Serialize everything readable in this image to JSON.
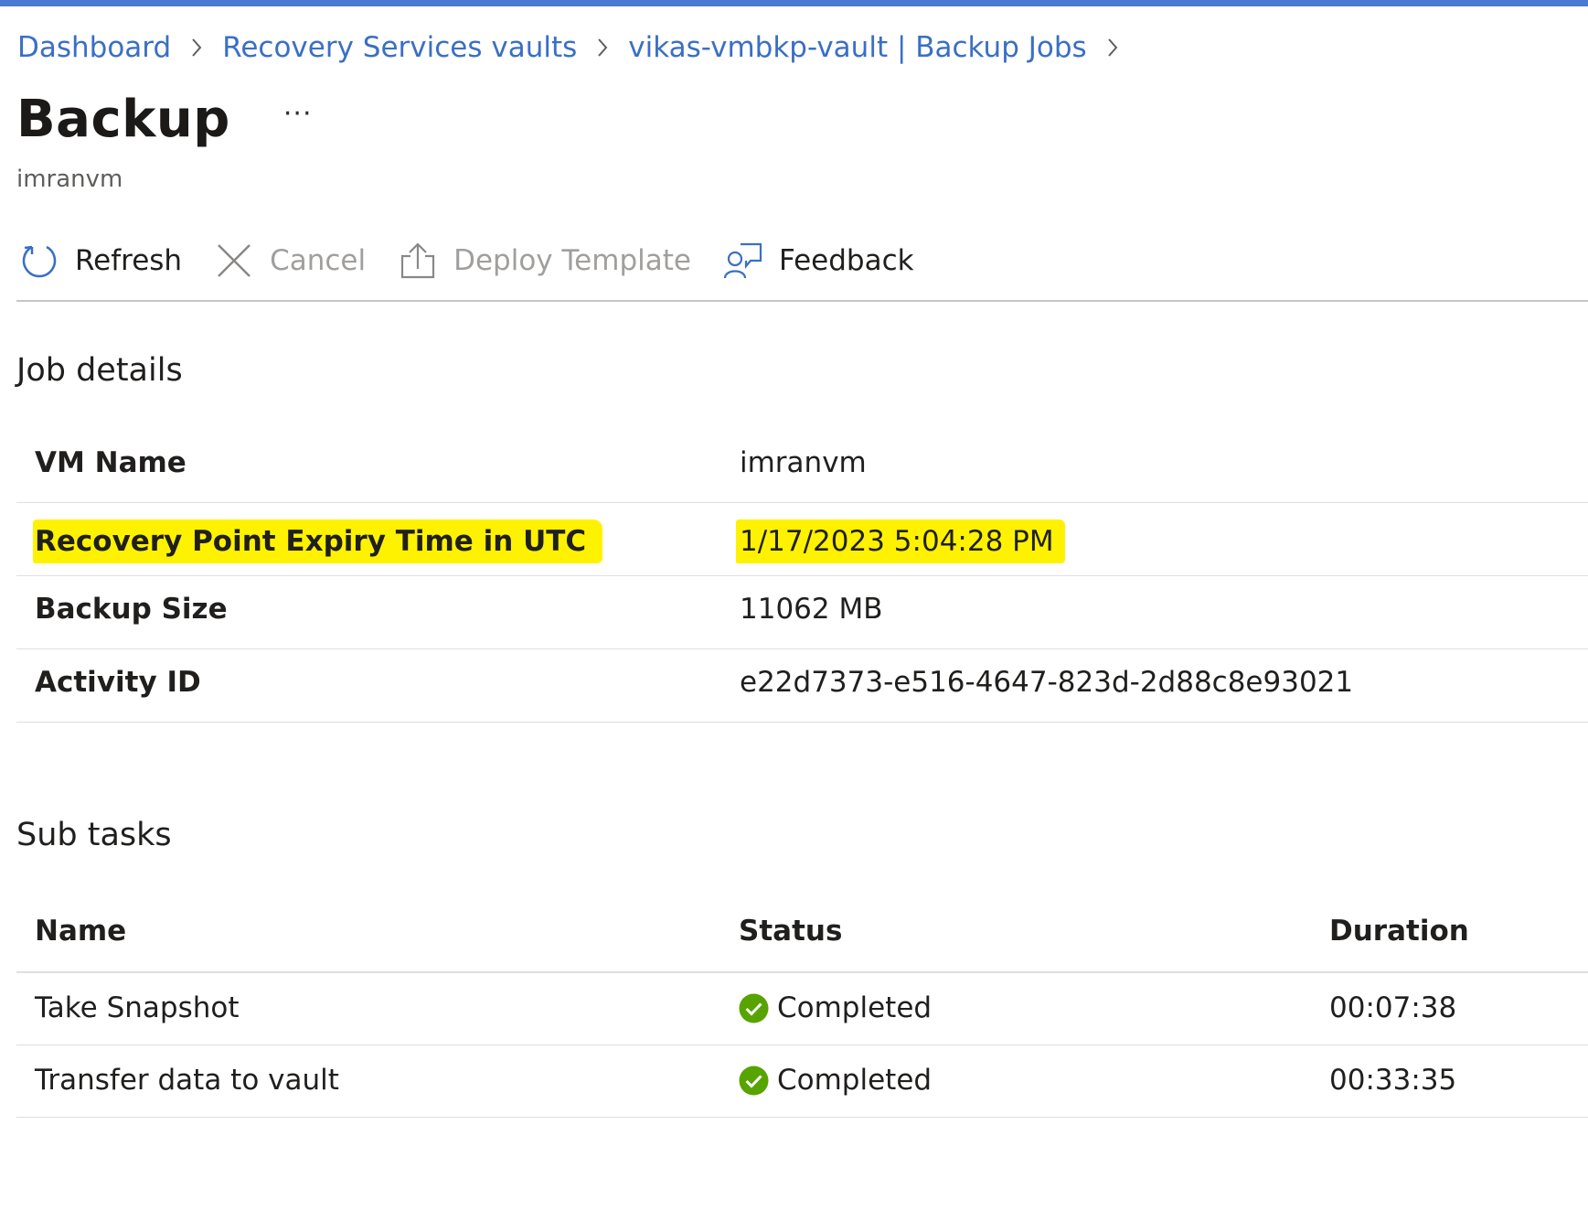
{
  "breadcrumb": {
    "items": [
      "Dashboard",
      "Recovery Services vaults",
      "vikas-vmbkp-vault | Backup Jobs"
    ]
  },
  "header": {
    "title": "Backup",
    "more_label": "···",
    "subtitle": "imranvm"
  },
  "toolbar": {
    "refresh_label": "Refresh",
    "cancel_label": "Cancel",
    "deploy_label": "Deploy Template",
    "feedback_label": "Feedback"
  },
  "job_details": {
    "title": "Job details",
    "rows": [
      {
        "label": "VM Name",
        "value": "imranvm"
      },
      {
        "label": "Recovery Point Expiry Time in UTC",
        "value": "1/17/2023 5:04:28 PM"
      },
      {
        "label": "Backup Size",
        "value": "11062 MB"
      },
      {
        "label": "Activity ID",
        "value": "e22d7373-e516-4647-823d-2d88c8e93021"
      }
    ]
  },
  "sub_tasks": {
    "title": "Sub tasks",
    "columns": [
      "Name",
      "Status",
      "Duration"
    ],
    "rows": [
      {
        "name": "Take Snapshot",
        "status": "Completed",
        "duration": "00:07:38"
      },
      {
        "name": "Transfer data to vault",
        "status": "Completed",
        "duration": "00:33:35"
      }
    ]
  },
  "colors": {
    "link": "#3a6fc4",
    "top_bar": "#4a7bd0",
    "highlight": "#fff200",
    "success": "#57a300"
  },
  "icons": {
    "refresh": "refresh-icon",
    "cancel": "cancel-x-icon",
    "deploy": "upload-icon",
    "feedback": "feedback-person-icon",
    "status": "check-circle-icon",
    "separator": "chevron-right-icon"
  }
}
